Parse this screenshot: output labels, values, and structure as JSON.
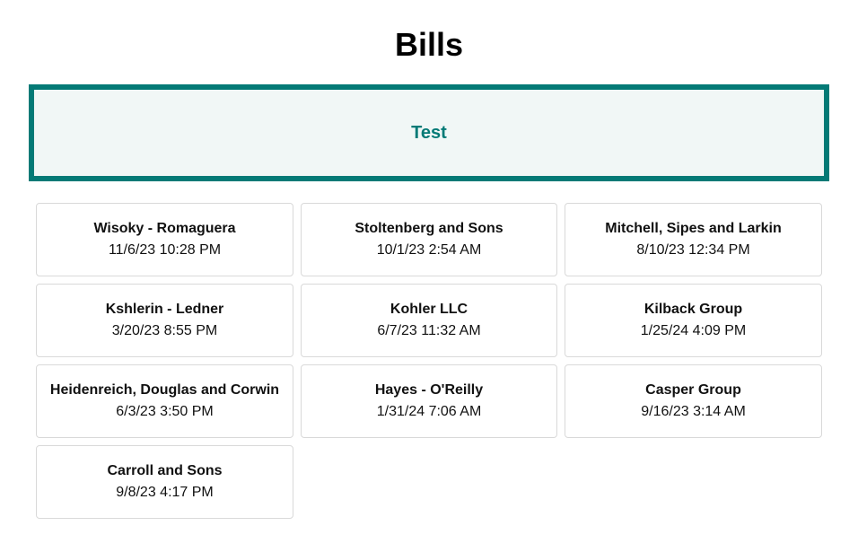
{
  "page": {
    "title": "Bills"
  },
  "banner": {
    "label": "Test"
  },
  "colors": {
    "accent": "#047a76",
    "banner_background": "#f1f7f6",
    "card_border": "#d9d9d9"
  },
  "bills": [
    {
      "name": "Wisoky - Romaguera",
      "date": "11/6/23 10:28 PM"
    },
    {
      "name": "Stoltenberg and Sons",
      "date": "10/1/23 2:54 AM"
    },
    {
      "name": "Mitchell, Sipes and Larkin",
      "date": "8/10/23 12:34 PM"
    },
    {
      "name": "Kshlerin - Ledner",
      "date": "3/20/23 8:55 PM"
    },
    {
      "name": "Kohler LLC",
      "date": "6/7/23 11:32 AM"
    },
    {
      "name": "Kilback Group",
      "date": "1/25/24 4:09 PM"
    },
    {
      "name": "Heidenreich, Douglas and Corwin",
      "date": "6/3/23 3:50 PM"
    },
    {
      "name": "Hayes - O'Reilly",
      "date": "1/31/24 7:06 AM"
    },
    {
      "name": "Casper Group",
      "date": "9/16/23 3:14 AM"
    },
    {
      "name": "Carroll and Sons",
      "date": "9/8/23 4:17 PM"
    }
  ]
}
